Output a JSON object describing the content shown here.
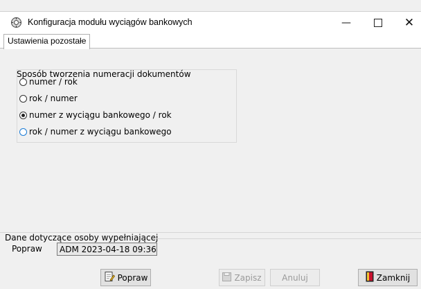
{
  "window": {
    "title": "Konfiguracja modułu wyciągów bankowych"
  },
  "tabs": [
    {
      "label": "Ustawienia pozostałe"
    }
  ],
  "numbering": {
    "legend": "Sposób tworzenia numeracji dokumentów",
    "options": [
      {
        "label": "numer / rok",
        "checked": false
      },
      {
        "label": "rok / numer",
        "checked": false
      },
      {
        "label": "numer z wyciągu bankowego / rok",
        "checked": true
      },
      {
        "label": "rok / numer z wyciągu bankowego",
        "checked": false
      }
    ]
  },
  "filler": {
    "section_label": "Dane dotyczące osoby wypełniającej",
    "field_label": "Popraw",
    "value": "ADM 2023-04-18 09:36"
  },
  "buttons": {
    "popraw": "Popraw",
    "zapisz": "Zapisz",
    "anuluj": "Anuluj",
    "zamknij": "Zamknij"
  }
}
